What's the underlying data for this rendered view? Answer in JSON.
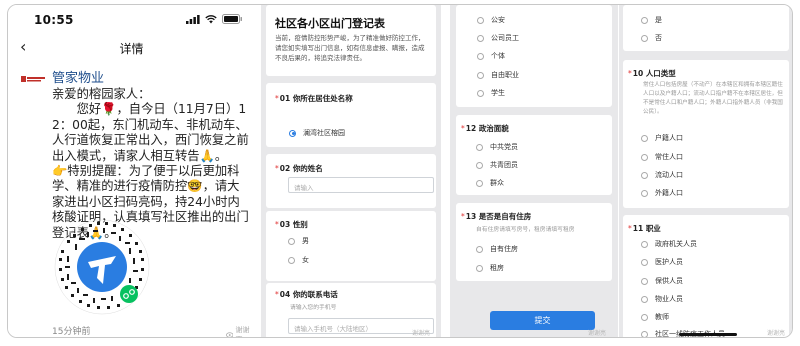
{
  "chat": {
    "status_time": "10:55",
    "nav_title": "详情",
    "back_glyph": "‹",
    "org_name": "管家物业",
    "message": "亲爱的榕园家人：\n　　您好🌹，自今日（11月7日）12：00起，东门机动车、非机动车、人行道恢复正常出入，西门恢复之前出入模式，请家人相互转告🙏。\n👉特别提醒：为了便于以后更加科学、精准的进行疫情防控🤓，请大家进出小区扫码亮码，持24小时内核酸证明，认真填写社区推出的出门登记表🙏。",
    "time_ago": "15分钟前",
    "seen_label": "谢谢亮"
  },
  "form1": {
    "title": "社区各小区出门登记表",
    "description": "当前，疫情防控形势严峻，为了精准做好防控工作，请您如实填写出门信息，如有信息虚报、瞒报，造成不良后果的，将追究法律责任。",
    "q1": {
      "num": "01",
      "label": "你所在居住处名称",
      "selected": "澜湾社区榕园"
    },
    "q2": {
      "num": "02",
      "label": "你的姓名",
      "placeholder": "请输入"
    },
    "q3": {
      "num": "03",
      "label": "性别",
      "options": [
        "男",
        "女"
      ]
    },
    "q4": {
      "num": "04",
      "label": "你的联系电话",
      "hint": "请输入您的手机号",
      "placeholder": "请输入手机号（大陆地区）"
    },
    "watermark": "谢谢亮"
  },
  "form2": {
    "top_options": [
      "公安",
      "公司员工",
      "个体",
      "自由职业",
      "学生"
    ],
    "q12": {
      "num": "12",
      "label": "政治面貌",
      "options": [
        "中共党员",
        "共青团员",
        "群众"
      ]
    },
    "q13": {
      "num": "13",
      "label": "是否是自有住房",
      "hint": "自有住房请填写房号，租房请填写租房",
      "options": [
        "自有住房",
        "租房"
      ]
    },
    "submit_label": "提交",
    "watermark": "谢谢亮"
  },
  "form3": {
    "top_options": [
      "是",
      "否"
    ],
    "q10": {
      "num": "10",
      "label": "人口类型",
      "description": "常住人口包括房屋（不动产）在本辖区和拥有本辖区籍住人口以及户籍人口；流动人口指户籍不在本辖区居住，但不是常住人口和户籍人口；外籍人口指外籍人员（非我国公民）。",
      "options": [
        "户籍人口",
        "常住人口",
        "流动人口",
        "外籍人口"
      ]
    },
    "q11": {
      "num": "11",
      "label": "职业",
      "options": [
        "政府机关人员",
        "医护人员",
        "保供人员",
        "物业人员",
        "教师",
        "社区一线防疫工作人员"
      ]
    },
    "watermark": "谢谢亮"
  },
  "colors": {
    "accent": "#2a7de1",
    "required": "#e03333",
    "org": "#1f4e8c"
  },
  "icons": [
    "signal-icon",
    "wifi-icon",
    "battery-icon",
    "back-icon",
    "qr-code-icon",
    "eye-icon"
  ]
}
